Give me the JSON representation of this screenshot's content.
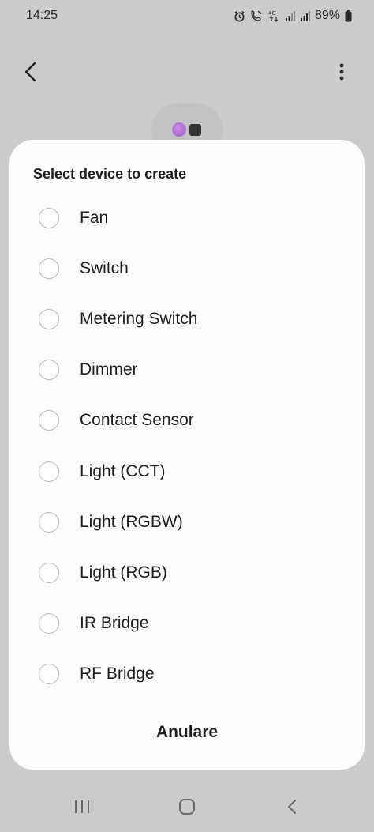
{
  "status_bar": {
    "time": "14:25",
    "battery_pct": "89%",
    "network": "4G",
    "icons": [
      "alarm-icon",
      "call-icon",
      "network-4g-icon",
      "signal-icon",
      "signal-icon",
      "battery-icon"
    ]
  },
  "header": {
    "back_icon": "back-arrow-icon",
    "more_icon": "more-vert-icon"
  },
  "dialog": {
    "title": "Select device to create",
    "options": [
      {
        "label": "Fan"
      },
      {
        "label": "Switch"
      },
      {
        "label": "Metering Switch"
      },
      {
        "label": "Dimmer"
      },
      {
        "label": "Contact Sensor"
      },
      {
        "label": "Light (CCT)"
      },
      {
        "label": "Light (RGBW)"
      },
      {
        "label": "Light (RGB)"
      },
      {
        "label": "IR Bridge"
      },
      {
        "label": "RF Bridge"
      }
    ],
    "cancel_label": "Anulare"
  },
  "nav_bar": {
    "icons": [
      "recent-apps-icon",
      "home-icon",
      "back-icon"
    ]
  },
  "colors": {
    "backdrop": "#cbcbcb",
    "dialog": "#fdfdfd",
    "radio_border": "#b9b9b9",
    "accent_dot": "#b478d8"
  }
}
